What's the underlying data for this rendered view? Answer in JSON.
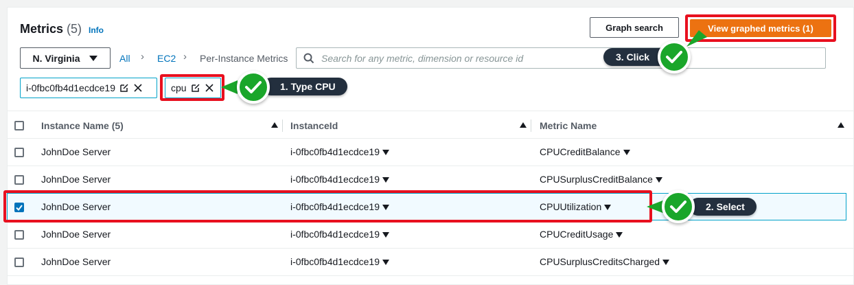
{
  "header": {
    "title": "Metrics",
    "count": "(5)",
    "info_label": "Info",
    "graph_search_label": "Graph search",
    "view_graphed_label": "View graphed metrics (1)"
  },
  "filters": {
    "region": "N. Virginia",
    "breadcrumb": [
      "All",
      "EC2",
      "Per-Instance Metrics"
    ],
    "search_placeholder": "Search for any metric, dimension or resource id",
    "tokens": [
      "i-0fbc0fb4d1ecdce19",
      "cpu"
    ]
  },
  "callouts": {
    "step1": "1. Type CPU",
    "step2": "2. Select",
    "step3": "3. Click"
  },
  "table": {
    "columns": [
      "Instance Name",
      "InstanceId",
      "Metric Name"
    ],
    "instance_count": "(5)",
    "rows": [
      {
        "instance_name": "JohnDoe Server",
        "instance_id": "i-0fbc0fb4d1ecdce19",
        "metric": "CPUCreditBalance",
        "checked": false
      },
      {
        "instance_name": "JohnDoe Server",
        "instance_id": "i-0fbc0fb4d1ecdce19",
        "metric": "CPUSurplusCreditBalance",
        "checked": false
      },
      {
        "instance_name": "JohnDoe Server",
        "instance_id": "i-0fbc0fb4d1ecdce19",
        "metric": "CPUUtilization",
        "checked": true
      },
      {
        "instance_name": "JohnDoe Server",
        "instance_id": "i-0fbc0fb4d1ecdce19",
        "metric": "CPUCreditUsage",
        "checked": false
      },
      {
        "instance_name": "JohnDoe Server",
        "instance_id": "i-0fbc0fb4d1ecdce19",
        "metric": "CPUSurplusCreditsCharged",
        "checked": false
      }
    ]
  },
  "colors": {
    "primary_button": "#ec7211",
    "highlight": "#e8101f",
    "check_green": "#1aa62a",
    "link": "#0073bb"
  }
}
